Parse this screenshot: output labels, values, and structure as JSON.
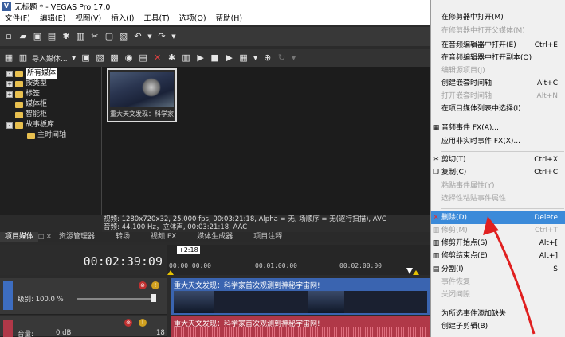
{
  "window": {
    "title": "无标题 * - VEGAS Pro 17.0",
    "app_icon": "V"
  },
  "menu": [
    "文件(F)",
    "编辑(E)",
    "视图(V)",
    "插入(I)",
    "工具(T)",
    "选项(O)",
    "帮助(H)"
  ],
  "media_toolbar": {
    "import_label": "导入媒体..."
  },
  "tree": {
    "items": [
      {
        "label": "所有媒体",
        "selected": true
      },
      {
        "label": "按类型"
      },
      {
        "label": "标签"
      },
      {
        "label": "媒体柜"
      },
      {
        "label": "智能柜"
      },
      {
        "label": "故事板库"
      },
      {
        "label": "主时间轴"
      }
    ]
  },
  "media": {
    "thumb_caption": "重大天文发现：科学家"
  },
  "info": {
    "line1": "视频: 1280x720x32, 25.000 fps, 00:03:21:18, Alpha = 无, 场顺序 = 无(逐行扫描), AVC",
    "line2": "音频: 44,100 Hz，立体声, 00:03:21:18, AAC"
  },
  "tabs": [
    {
      "label": "项目媒体",
      "active": true
    },
    {
      "label": "资源管理器"
    },
    {
      "label": "转场"
    },
    {
      "label": "视频 FX"
    },
    {
      "label": "媒体生成器"
    },
    {
      "label": "项目注释"
    }
  ],
  "timeline": {
    "timecode": "00:02:39:09",
    "offset_badge": "+2:18",
    "ticks": [
      "00:00:00:00",
      "00:01:00:00",
      "00:02:00:00"
    ],
    "video_track": {
      "level_label": "级别: 100.0 %",
      "clip_title": "重大天文发现：科学家首次观测到神秘宇宙网!"
    },
    "audio_track": {
      "volume_label": "音量:",
      "volume_value": "0 dB",
      "side_value": "18",
      "clip_title": "重大天文发现：科学家首次观测到神秘宇宙网!"
    }
  },
  "context_menu": {
    "items": [
      {
        "label": "在修剪器中打开(M)",
        "shortcut": "",
        "disabled": false,
        "icon": ""
      },
      {
        "label": "在修剪器中打开父媒体(M)",
        "shortcut": "",
        "disabled": true,
        "icon": ""
      },
      {
        "label": "在音频编辑器中打开(E)",
        "shortcut": "Ctrl+E",
        "disabled": false,
        "icon": ""
      },
      {
        "label": "在音频编辑器中打开副本(O)",
        "shortcut": "",
        "disabled": false,
        "icon": ""
      },
      {
        "label": "编辑源项目(J)",
        "shortcut": "",
        "disabled": true,
        "icon": ""
      },
      {
        "label": "创建嵌套时间轴",
        "shortcut": "Alt+C",
        "disabled": false,
        "icon": ""
      },
      {
        "label": "打开嵌套时间轴",
        "shortcut": "Alt+N",
        "disabled": true,
        "icon": ""
      },
      {
        "label": "在项目媒体列表中选择(I)",
        "shortcut": "",
        "disabled": false,
        "icon": ""
      },
      {
        "label": "音频事件 FX(A)...",
        "shortcut": "",
        "disabled": false,
        "icon": "fx-icon"
      },
      {
        "label": "应用非实时事件 FX(X)...",
        "shortcut": "",
        "disabled": false,
        "icon": ""
      },
      {
        "label": "剪切(T)",
        "shortcut": "Ctrl+X",
        "disabled": false,
        "icon": "scissors-icon"
      },
      {
        "label": "复制(C)",
        "shortcut": "Ctrl+C",
        "disabled": false,
        "icon": "copy-icon"
      },
      {
        "label": "粘贴事件属性(Y)",
        "shortcut": "",
        "disabled": true,
        "icon": ""
      },
      {
        "label": "选择性粘贴事件属性",
        "shortcut": "",
        "disabled": true,
        "icon": ""
      },
      {
        "label": "删除(D)",
        "shortcut": "Delete",
        "disabled": false,
        "highlight": true,
        "icon": "delete-icon"
      },
      {
        "label": "修剪(M)",
        "shortcut": "Ctrl+T",
        "disabled": true,
        "icon": "trim-icon"
      },
      {
        "label": "修剪开始点(S)",
        "shortcut": "Alt+[",
        "disabled": false,
        "icon": "trim-start-icon"
      },
      {
        "label": "修剪结束点(E)",
        "shortcut": "Alt+]",
        "disabled": false,
        "icon": "trim-end-icon"
      },
      {
        "label": "分割(I)",
        "shortcut": "S",
        "disabled": false,
        "icon": "split-icon"
      },
      {
        "label": "事件恢复",
        "shortcut": "",
        "disabled": true,
        "icon": ""
      },
      {
        "label": "关闭间隙",
        "shortcut": "",
        "disabled": true,
        "icon": ""
      },
      {
        "label": "为所选事件添加缺失",
        "shortcut": "",
        "disabled": false,
        "icon": ""
      },
      {
        "label": "创建子剪辑(B)",
        "shortcut": "",
        "disabled": false,
        "icon": ""
      }
    ]
  },
  "colors": {
    "highlight": "#3b8ad9",
    "video_track": "#3a64b0",
    "audio_track": "#b03848",
    "arrow": "#e02020"
  }
}
